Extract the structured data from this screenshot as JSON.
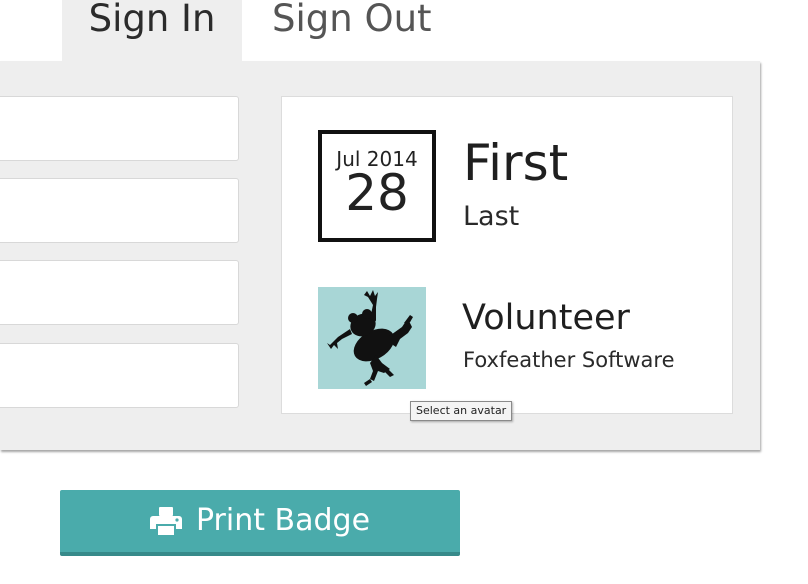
{
  "tabs": [
    {
      "label": "Sign In",
      "active": true
    },
    {
      "label": "Sign Out",
      "active": false
    }
  ],
  "form": {
    "fields": [
      {
        "value": ""
      },
      {
        "value": ""
      },
      {
        "value": ""
      },
      {
        "value": ""
      }
    ]
  },
  "badge": {
    "date_month": "Jul 2014",
    "date_day": "28",
    "first_name": "First",
    "last_name": "Last",
    "role": "Volunteer",
    "company": "Foxfeather Software",
    "avatar_icon": "frog-icon",
    "avatar_bg": "#a8d6d6"
  },
  "tooltip": {
    "text": "Select an avatar"
  },
  "print_button": {
    "label": "Print Badge",
    "icon": "printer-icon",
    "color": "#4aabab"
  }
}
